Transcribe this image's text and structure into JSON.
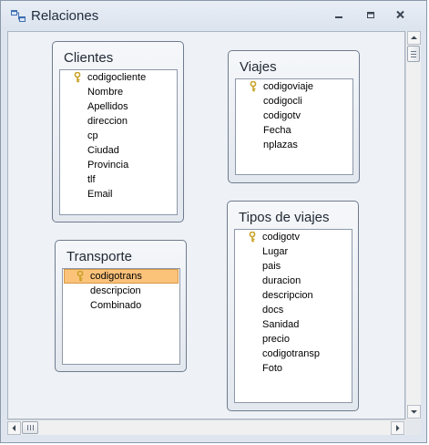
{
  "window": {
    "title": "Relaciones"
  },
  "tables": [
    {
      "name": "Clientes",
      "fields": [
        {
          "label": "codigocliente",
          "key": true
        },
        {
          "label": "Nombre"
        },
        {
          "label": "Apellidos"
        },
        {
          "label": "direccion"
        },
        {
          "label": "cp"
        },
        {
          "label": "Ciudad"
        },
        {
          "label": "Provincia"
        },
        {
          "label": "tlf"
        },
        {
          "label": "Email"
        }
      ]
    },
    {
      "name": "Viajes",
      "fields": [
        {
          "label": "codigoviaje",
          "key": true
        },
        {
          "label": "codigocli"
        },
        {
          "label": "codigotv"
        },
        {
          "label": "Fecha"
        },
        {
          "label": "nplazas"
        }
      ]
    },
    {
      "name": "Transporte",
      "fields": [
        {
          "label": "codigotrans",
          "key": true,
          "selected": true
        },
        {
          "label": "descripcion"
        },
        {
          "label": "Combinado"
        }
      ]
    },
    {
      "name": "Tipos de viajes",
      "fields": [
        {
          "label": "codigotv",
          "key": true
        },
        {
          "label": "Lugar"
        },
        {
          "label": "pais"
        },
        {
          "label": "duracion"
        },
        {
          "label": "descripcion"
        },
        {
          "label": "docs"
        },
        {
          "label": "Sanidad"
        },
        {
          "label": "precio"
        },
        {
          "label": "codigotransp"
        },
        {
          "label": "Foto"
        }
      ]
    }
  ],
  "icons": {
    "title": "relationships-icon",
    "key": "primary-key-icon"
  },
  "colors": {
    "selected_field": "#fbc27a",
    "key_icon": "#c9a227"
  }
}
